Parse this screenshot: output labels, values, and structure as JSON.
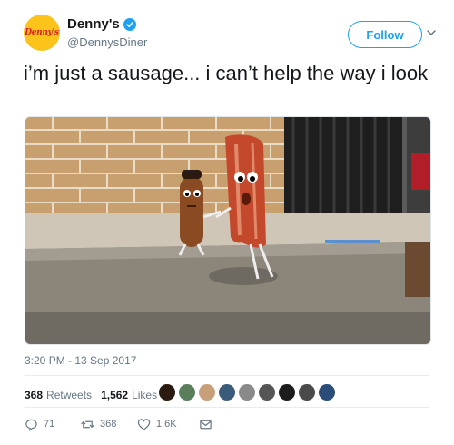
{
  "account": {
    "display_name": "Denny's",
    "handle": "@DennysDiner",
    "logo_text": "Denny's",
    "verified": true,
    "brand_color": "#fcc31a"
  },
  "follow_button": {
    "label": "Follow",
    "color": "#1da1f2"
  },
  "menu": {
    "icon": "chevron-down-icon"
  },
  "tweet": {
    "text": "i’m just a sausage... i can’t help the way i look",
    "timestamp": "3:20 PM - 13 Sep 2017"
  },
  "stats": {
    "retweets_count": "368",
    "retweets_label": "Retweets",
    "likes_count": "1,562",
    "likes_label": "Likes",
    "liker_avatar_colors": [
      "#2b1a10",
      "#5a7d5a",
      "#c7a07a",
      "#3b5b7a",
      "#8a8a8a",
      "#555555",
      "#1c1c1c",
      "#4a4a4a",
      "#2a4d7a"
    ]
  },
  "actions": {
    "reply_count": "71",
    "retweet_count": "368",
    "like_count": "1.6K",
    "reply_icon": "reply-icon",
    "retweet_icon": "retweet-icon",
    "like_icon": "heart-icon",
    "message_icon": "envelope-icon"
  }
}
